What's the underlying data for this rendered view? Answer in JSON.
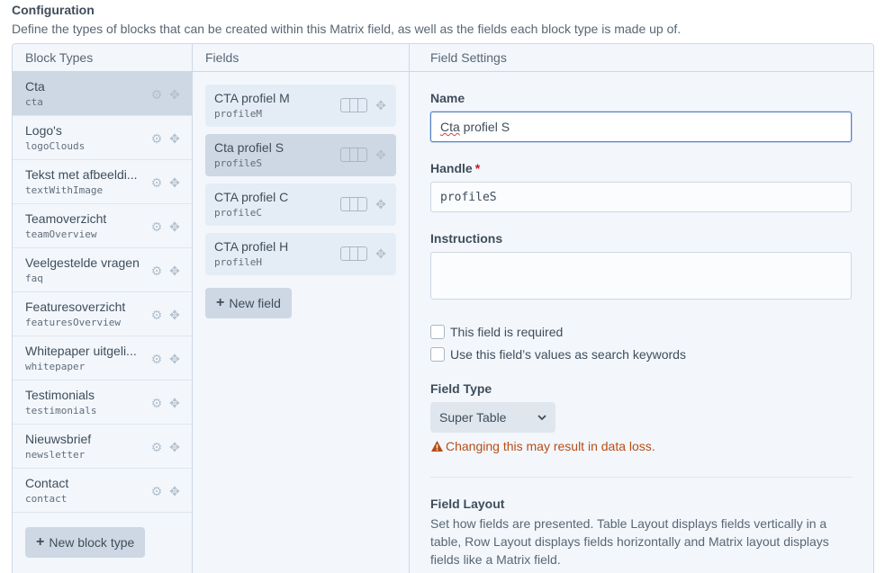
{
  "header": {
    "title": "Configuration",
    "description": "Define the types of blocks that can be created within this Matrix field, as well as the fields each block type is made up of."
  },
  "columns": {
    "blocks": "Block Types",
    "fields": "Fields",
    "settings": "Field Settings"
  },
  "block_types": [
    {
      "name": "Cta",
      "handle": "cta"
    },
    {
      "name": "Logo's",
      "handle": "logoClouds"
    },
    {
      "name": "Tekst met afbeeldi...",
      "handle": "textWithImage"
    },
    {
      "name": "Teamoverzicht",
      "handle": "teamOverview"
    },
    {
      "name": "Veelgestelde vragen",
      "handle": "faq"
    },
    {
      "name": "Featuresoverzicht",
      "handle": "featuresOverview"
    },
    {
      "name": "Whitepaper uitgeli...",
      "handle": "whitepaper"
    },
    {
      "name": "Testimonials",
      "handle": "testimonials"
    },
    {
      "name": "Nieuwsbrief",
      "handle": "newsletter"
    },
    {
      "name": "Contact",
      "handle": "contact"
    }
  ],
  "new_block_label": "New block type",
  "fields": [
    {
      "name": "CTA profiel M",
      "handle": "profileM"
    },
    {
      "name": "Cta profiel S",
      "handle": "profileS"
    },
    {
      "name": "CTA profiel C",
      "handle": "profileC"
    },
    {
      "name": "CTA profiel H",
      "handle": "profileH"
    }
  ],
  "new_field_label": "New field",
  "settings": {
    "name_label": "Name",
    "name_value_prefix": "Cta",
    "name_value_rest": " profiel S",
    "handle_label": "Handle",
    "handle_required": "*",
    "handle_value": "profileS",
    "instructions_label": "Instructions",
    "required_label": "This field is required",
    "search_label": "Use this field’s values as search keywords",
    "type_label": "Field Type",
    "type_value": "Super Table",
    "warning": "Changing this may result in data loss.",
    "layout_label": "Field Layout",
    "layout_desc": "Set how fields are presented. Table Layout displays fields vertically in a table, Row Layout displays fields horizontally and Matrix layout displays fields like a Matrix field."
  },
  "colors": {
    "accent": "#5782c2",
    "warning": "#b84d14",
    "required": "#cf1124"
  }
}
